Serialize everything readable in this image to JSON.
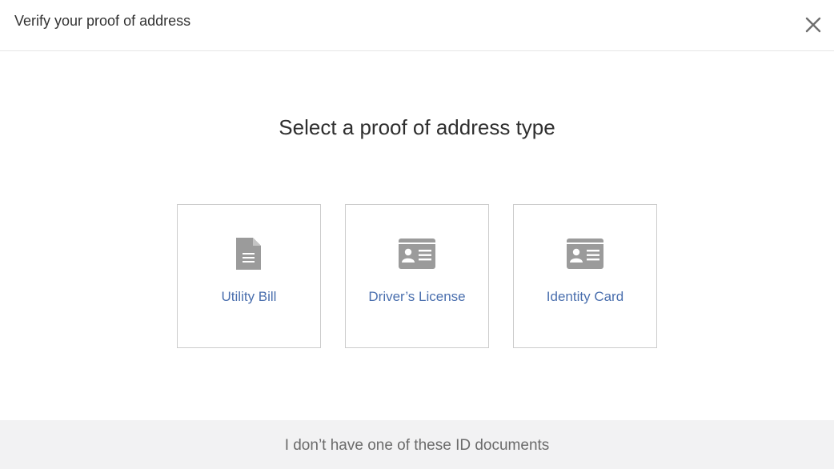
{
  "header": {
    "title": "Verify your proof of address",
    "close_icon": "close-icon"
  },
  "main": {
    "title": "Select a proof of address type",
    "options": [
      {
        "label": "Utility Bill",
        "icon": "document-icon"
      },
      {
        "label": "Driver’s License",
        "icon": "id-card-icon"
      },
      {
        "label": "Identity Card",
        "icon": "id-card-icon"
      }
    ]
  },
  "footer": {
    "link_label": "I don’t have one of these ID documents"
  },
  "colors": {
    "option_label": "#4a6fae",
    "icon": "#9b9b9b",
    "card_border": "#cccccc",
    "footer_bg": "#f2f2f3"
  }
}
